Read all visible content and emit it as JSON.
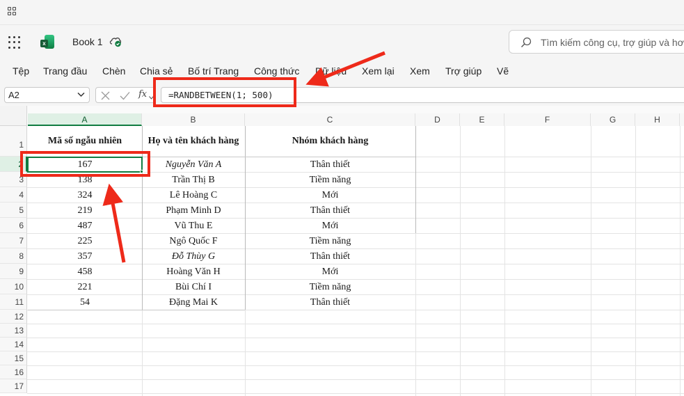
{
  "app": {
    "title": "Book 1",
    "search_placeholder": "Tìm kiếm công cụ, trợ giúp và hơn"
  },
  "ribbon": {
    "tabs": [
      "Tệp",
      "Trang đầu",
      "Chèn",
      "Chia sẻ",
      "Bố trí Trang",
      "Công thức",
      "Dữ liệu",
      "Xem lại",
      "Xem",
      "Trợ giúp",
      "Vẽ"
    ]
  },
  "formula_bar": {
    "name_box": "A2",
    "fx_label": "fx",
    "formula": "=RANDBETWEEN(1; 500)"
  },
  "sheet": {
    "columns": [
      "A",
      "B",
      "C",
      "D",
      "E",
      "F",
      "G",
      "H"
    ],
    "rows": [
      "1",
      "2",
      "3",
      "4",
      "5",
      "6",
      "7",
      "8",
      "9",
      "10",
      "11",
      "12",
      "13",
      "14",
      "15",
      "16",
      "17"
    ],
    "header": {
      "a": "Mã số ngẫu nhiên",
      "b": "Họ và tên khách hàng",
      "c": "Nhóm khách hàng"
    },
    "data": [
      {
        "a": "167",
        "b": "Nguyễn Văn A",
        "c": "Thân thiết"
      },
      {
        "a": "138",
        "b": "Trần Thị B",
        "c": "Tiềm năng"
      },
      {
        "a": "324",
        "b": "Lê Hoàng C",
        "c": "Mới"
      },
      {
        "a": "219",
        "b": "Phạm Minh D",
        "c": "Thân thiết"
      },
      {
        "a": "487",
        "b": "Vũ Thu E",
        "c": "Mới"
      },
      {
        "a": "225",
        "b": "Ngô Quốc F",
        "c": "Tiềm năng"
      },
      {
        "a": "357",
        "b": "Đỗ Thùy G",
        "c": "Thân thiết"
      },
      {
        "a": "458",
        "b": "Hoàng Văn H",
        "c": "Mới"
      },
      {
        "a": "221",
        "b": "Bùi Chí I",
        "c": "Tiềm năng"
      },
      {
        "a": "54",
        "b": "Đặng Mai K",
        "c": "Thân thiết"
      }
    ],
    "active_cell": "A2"
  },
  "colors": {
    "accent": "#107c41",
    "annotation": "#ee2a1a"
  }
}
